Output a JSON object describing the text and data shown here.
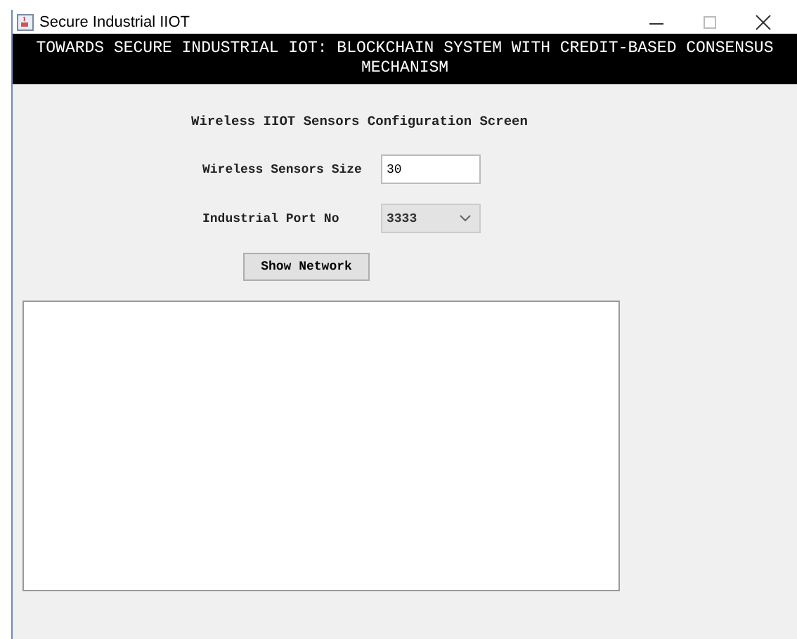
{
  "window": {
    "title": "Secure Industrial IIOT"
  },
  "banner": "TOWARDS SECURE INDUSTRIAL IOT: BLOCKCHAIN SYSTEM WITH CREDIT-BASED CONSENSUS MECHANISM",
  "heading": "Wireless IIOT Sensors Configuration Screen",
  "fields": [
    {
      "kind": "text",
      "label": "Wireless Sensors Size",
      "value": "30"
    },
    {
      "kind": "combo",
      "label": "Industrial Port No",
      "value": "3333"
    }
  ],
  "button": "Show Network"
}
